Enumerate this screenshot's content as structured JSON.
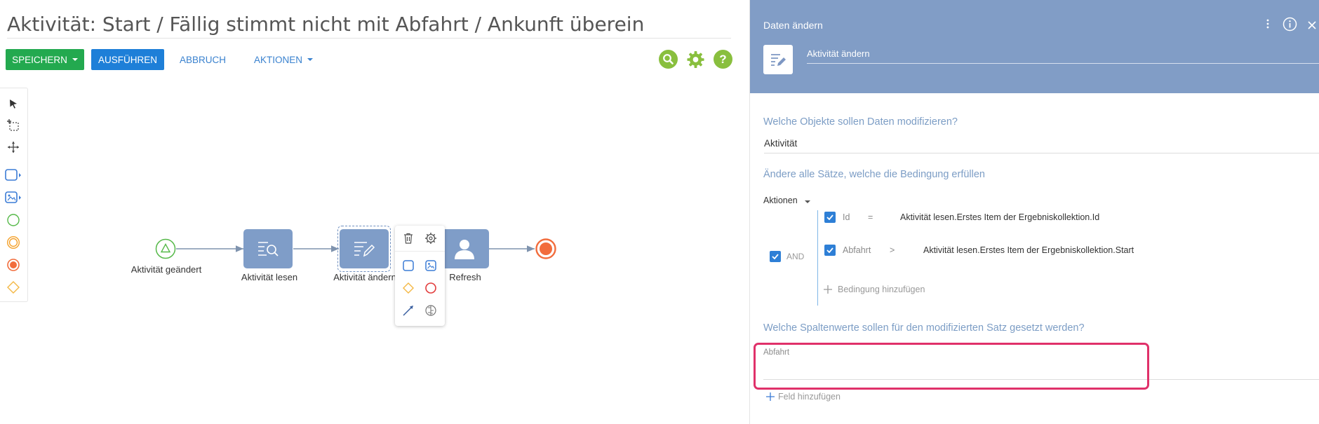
{
  "page": {
    "title": "Aktivität: Start / Fällig stimmt nicht mit Abfahrt / Ankunft überein"
  },
  "toolbar": {
    "save_label": "SPEICHERN",
    "run_label": "AUSFÜHREN",
    "cancel_label": "ABBRUCH",
    "actions_label": "AKTIONEN",
    "help_glyph": "?"
  },
  "palette": {
    "items": [
      "pointer-icon",
      "marquee-select-icon",
      "move-canvas-icon",
      "task-icon",
      "subprocess-icon",
      "start-event-icon",
      "intermediate-event-icon",
      "end-event-icon",
      "gateway-icon"
    ]
  },
  "diagram": {
    "nodes": [
      {
        "label": "Aktivität geändert",
        "kind": "start-event"
      },
      {
        "label": "Aktivität lesen",
        "kind": "read-data-task"
      },
      {
        "label": "Aktivität ändern",
        "kind": "modify-data-task"
      },
      {
        "label": "Refresh",
        "kind": "user-task"
      },
      {
        "label": "",
        "kind": "end-event"
      }
    ]
  },
  "panel": {
    "title": "Daten ändern",
    "element_name": "Aktivität ändern",
    "q_objects": "Welche Objekte sollen Daten modifizieren?",
    "object_value": "Aktivität",
    "q_condition": "Ändere alle Sätze, welche die Bedingung erfüllen",
    "actions_label": "Aktionen",
    "and_label": "AND",
    "conditions": [
      {
        "column": "Id",
        "operator": "=",
        "value": "Aktivität lesen.Erstes Item der Ergebniskollektion.Id"
      },
      {
        "column": "Abfahrt",
        "operator": ">",
        "value": "Aktivität lesen.Erstes Item der Ergebniskollektion.Start"
      }
    ],
    "add_condition_label": "Bedingung hinzufügen",
    "q_columns": "Welche Spaltenwerte sollen für den modifizierten Satz gesetzt werden?",
    "field_label": "Abfahrt",
    "add_field_label": "Feld hinzufügen"
  },
  "colors": {
    "save_green": "#23a94f",
    "run_blue": "#1e7fd8",
    "panel_header": "#819dc6",
    "task_fill": "#7f9dc8",
    "highlight_red": "#e0316a",
    "end_event_orange": "#f26c3c"
  }
}
